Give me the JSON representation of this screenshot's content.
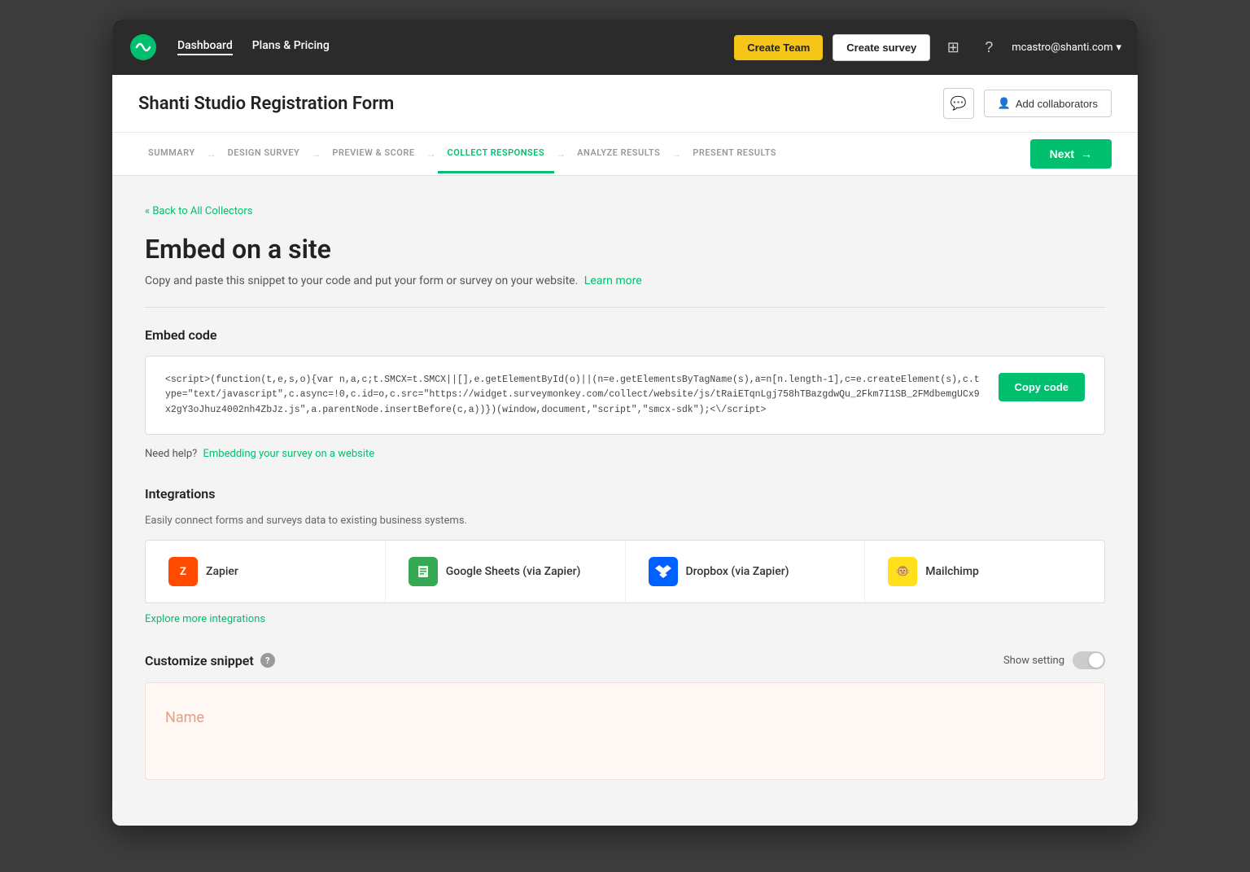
{
  "nav": {
    "links": [
      {
        "label": "Dashboard",
        "active": true
      },
      {
        "label": "Plans & Pricing",
        "active": false
      }
    ],
    "create_team_label": "Create Team",
    "create_survey_label": "Create survey",
    "user_email": "mcastro@shanti.com"
  },
  "survey_header": {
    "title": "Shanti Studio Registration Form",
    "comment_icon": "💬",
    "add_collaborators_label": "Add collaborators"
  },
  "steps": [
    {
      "label": "SUMMARY",
      "active": false
    },
    {
      "label": "DESIGN SURVEY",
      "active": false
    },
    {
      "label": "PREVIEW & SCORE",
      "active": false
    },
    {
      "label": "COLLECT RESPONSES",
      "active": true
    },
    {
      "label": "ANALYZE RESULTS",
      "active": false
    },
    {
      "label": "PRESENT RESULTS",
      "active": false
    }
  ],
  "next_button_label": "Next",
  "back_link": "« Back to All Collectors",
  "page_title": "Embed on a site",
  "page_subtitle": "Copy and paste this snippet to your code and put your form or survey on your website.",
  "learn_more_label": "Learn more",
  "embed_code_section": {
    "title": "Embed code",
    "code": "<script>(function(t,e,s,o){var n,a,c;t.SMCX=t.SMCX||[],e.getElementById(o)||(n=e.getElementsByTagName(s),a=n[n.length-1],c=e.createElement(s),c.type=\"text/javascript\",c.async=!0,c.id=o,c.src=\"https://widget.surveymonkey.com/collect/website/js/tRaiETqnLgj758hTBazgdwQu_2Fkm7I1SB_2FMdbemgUCx9x2gY3oJhuz4002nh4ZbJz.js\",a.parentNode.insertBefore(c,a))})(window,document,\"script\",\"smcx-sdk\");<\\/script>",
    "copy_button_label": "Copy code"
  },
  "help_text": "Need help?",
  "embedding_link_label": "Embedding your survey on a website",
  "integrations": {
    "title": "Integrations",
    "subtitle": "Easily connect forms and surveys data to existing business systems.",
    "items": [
      {
        "name": "Zapier",
        "icon_type": "zapier",
        "icon_text": "Z"
      },
      {
        "name": "Google Sheets (via Zapier)",
        "icon_type": "gsheets",
        "icon_text": "📊"
      },
      {
        "name": "Dropbox (via Zapier)",
        "icon_type": "dropbox",
        "icon_text": "◆"
      },
      {
        "name": "Mailchimp",
        "icon_type": "mailchimp",
        "icon_text": "🐵"
      }
    ],
    "explore_label": "Explore more integrations"
  },
  "customize": {
    "title": "Customize snippet",
    "show_setting_label": "Show setting"
  },
  "snippet_preview": {
    "placeholder": "Name"
  }
}
